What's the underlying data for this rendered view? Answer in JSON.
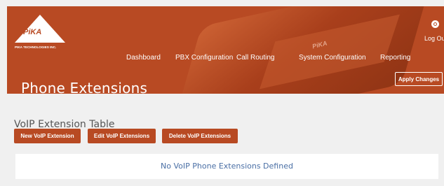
{
  "brand": {
    "logo_text": "PiKA",
    "company": "PIKA TECHNOLOGIES INC.",
    "device_logo": "PiKA"
  },
  "nav": {
    "items": [
      {
        "label": "Dashboard"
      },
      {
        "label": "PBX Configuration"
      },
      {
        "label": "Call Routing"
      },
      {
        "label": "System Configuration"
      },
      {
        "label": "Reporting"
      }
    ]
  },
  "user": {
    "logout_label": "Log Out"
  },
  "header": {
    "title": "Phone Extensions",
    "apply_label": "Apply Changes"
  },
  "main": {
    "section_title": "VoIP Extension Table",
    "buttons": {
      "new_label": "New VoIP Extension",
      "edit_label": "Edit VoIP Extensions",
      "delete_label": "Delete VoIP Extensions"
    },
    "empty_message": "No VoIP Phone Extensions Defined"
  },
  "colors": {
    "brand": "#b84a23",
    "page_bg": "#f0f0f0",
    "empty_text": "#4a6fa5"
  }
}
